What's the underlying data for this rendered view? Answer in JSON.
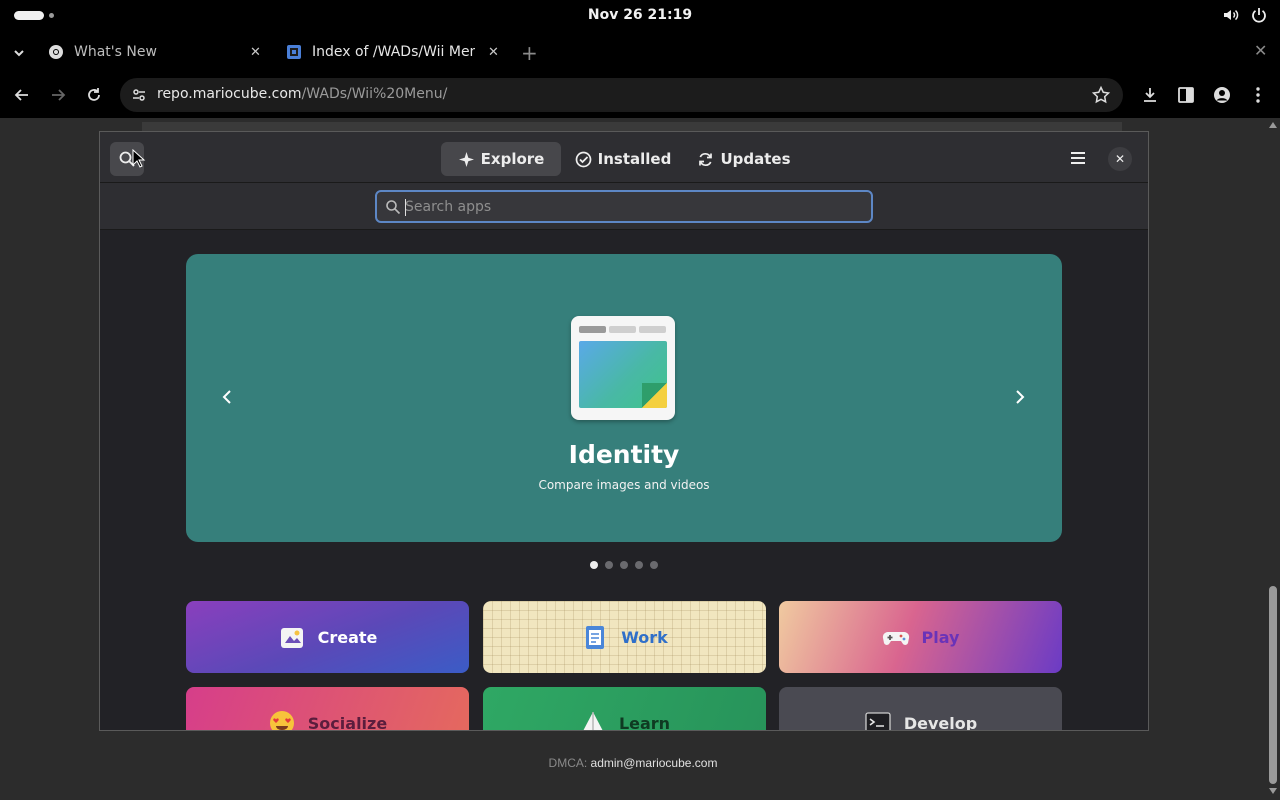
{
  "system": {
    "clock": "Nov 26  21:19"
  },
  "tabs": [
    {
      "title": "What's New",
      "active": false
    },
    {
      "title": "Index of /WADs/Wii Menu",
      "active": true
    }
  ],
  "address_bar": {
    "host": "repo.mariocube.com",
    "path": "/WADs/Wii%20Menu/"
  },
  "software": {
    "tabs": [
      {
        "label": "Explore",
        "icon": "sparkle-icon",
        "active": true
      },
      {
        "label": "Installed",
        "icon": "check-circle-icon",
        "active": false
      },
      {
        "label": "Updates",
        "icon": "refresh-icon",
        "active": false
      }
    ],
    "search": {
      "placeholder": "Search apps"
    },
    "featured": {
      "name": "Identity",
      "description": "Compare images and videos",
      "background": "#367f7b",
      "slide_count": 5,
      "current_slide": 1
    },
    "categories": [
      {
        "label": "Create",
        "icon": "create-icon"
      },
      {
        "label": "Work",
        "icon": "work-icon"
      },
      {
        "label": "Play",
        "icon": "gamepad-icon"
      },
      {
        "label": "Socialize",
        "icon": "heart-eyes-icon"
      },
      {
        "label": "Learn",
        "icon": "learn-icon"
      },
      {
        "label": "Develop",
        "icon": "terminal-icon"
      }
    ]
  },
  "footer": {
    "label": "DMCA:",
    "email": "admin@mariocube.com"
  },
  "colors": {
    "accent": "#5d87c5",
    "window_bg": "#222226",
    "header_bg": "#2e2e32"
  }
}
